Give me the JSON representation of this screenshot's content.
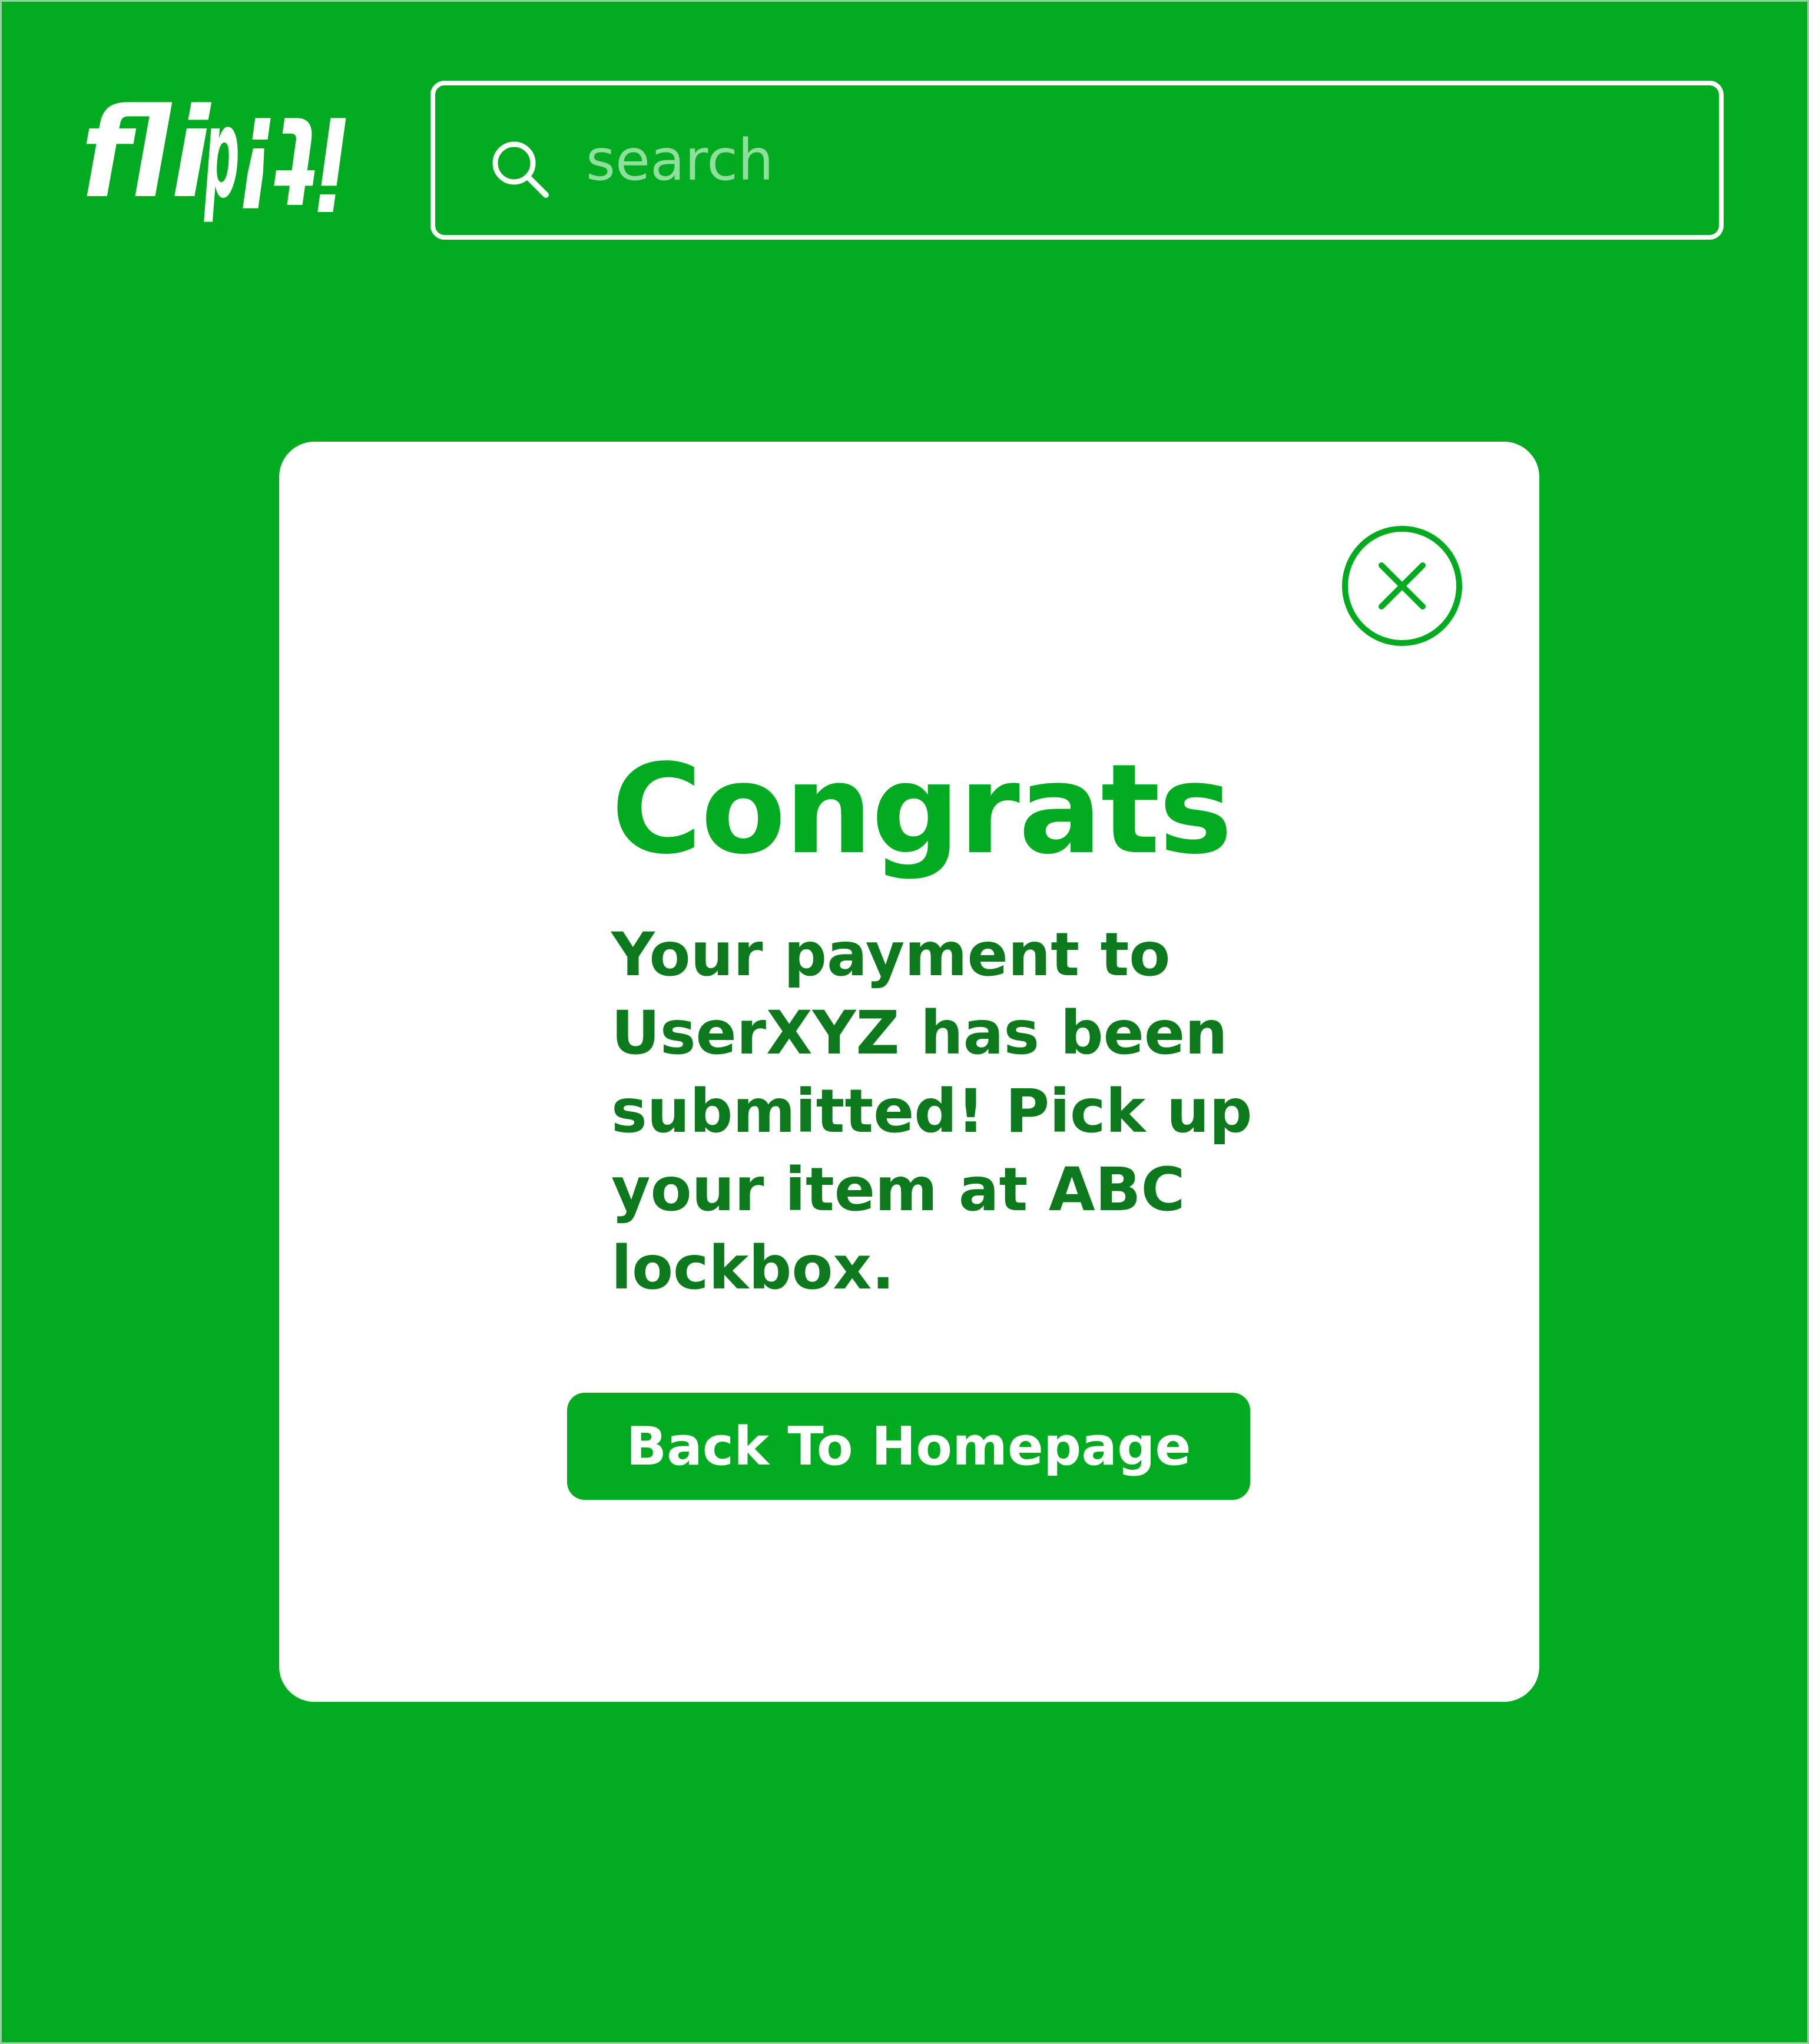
{
  "header": {
    "logo_text": "flipit!",
    "search": {
      "placeholder": "search",
      "value": "",
      "icon": "search-icon"
    }
  },
  "modal": {
    "close_icon": "close-icon",
    "title": "Congrats",
    "message": "Your payment to UserXYZ has been submitted! Pick up your item at ABC lockbox.",
    "button_label": "Back To Homepage"
  },
  "colors": {
    "background": "#00ab20",
    "card": "#ffffff",
    "title": "#00ab20",
    "message": "#0c7a1c",
    "button": "#00ab20",
    "button_text": "#ffffff",
    "placeholder": "#8fe09c"
  }
}
